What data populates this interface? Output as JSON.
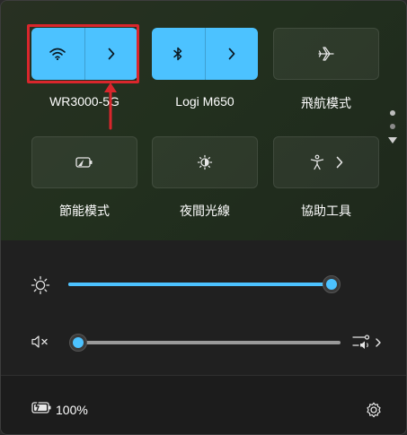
{
  "quick_settings": {
    "row1": [
      {
        "label": "WR3000-5G",
        "icon": "wifi-icon",
        "state": "on",
        "has_chevron": true
      },
      {
        "label": "Logi M650",
        "icon": "bluetooth-icon",
        "state": "on",
        "has_chevron": true
      },
      {
        "label": "飛航模式",
        "icon": "airplane-icon",
        "state": "off",
        "has_chevron": false
      }
    ],
    "row2": [
      {
        "label": "節能模式",
        "icon": "battery-saver-icon",
        "state": "off"
      },
      {
        "label": "夜間光線",
        "icon": "night-light-icon",
        "state": "off"
      },
      {
        "label": "協助工具",
        "icon": "accessibility-icon",
        "state": "off",
        "has_chevron": true
      }
    ],
    "pager": {
      "pages": 2,
      "current": 1
    }
  },
  "sliders": {
    "brightness": {
      "icon": "brightness-icon",
      "value_percent": 100
    },
    "volume": {
      "icon": "volume-muted-icon",
      "value_percent": 0,
      "muted": true,
      "output_icon": "audio-output-icon"
    }
  },
  "footer": {
    "battery_text": "100%",
    "battery_icon": "battery-charging-icon",
    "settings_icon": "gear-icon"
  },
  "colors": {
    "accent": "#4cc2ff",
    "annotation": "#d9262c"
  }
}
